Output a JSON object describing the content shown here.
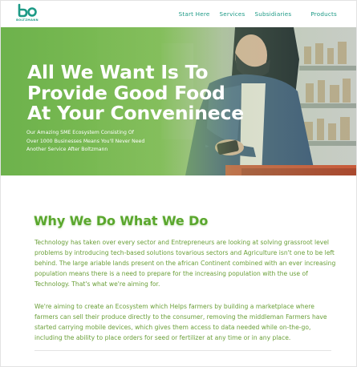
{
  "brand": {
    "logo_text": "BOLTZMANN",
    "accent": "#1d9a86",
    "green": "#5aa72d"
  },
  "nav": {
    "links": [
      {
        "label": "Start Here"
      },
      {
        "label": "Services"
      },
      {
        "label": "Subsidiaries"
      },
      {
        "label": "Products"
      }
    ]
  },
  "hero": {
    "title_line_1": "All We Want Is To",
    "title_line_2": "Provide Good Food",
    "title_line_3": "At Your Conveninece",
    "subtitle_line_1": "Our Amazing SME Ecosystem Consisting Of",
    "subtitle_line_2": "Over 1000 Businesses Means You'll Never Need",
    "subtitle_line_3": "Another Service After Boltzmann"
  },
  "about": {
    "title": "Why We Do What We Do",
    "paragraph_1": "Technology has taken over every sector and Entrepreneurs are looking at solving grassroot level problems by introducing tech-based solutions tovarious sectors and Agriculture isn't one to be left behind. The large ariable lands present on the african Continent combined with an ever increasing population means there is a need to prepare for the increasing population with the use of Technology. That's what we're aiming for.",
    "paragraph_2": "We're aiming to create an Ecosystem which Helps farmers by building a marketplace where farmers can sell their produce directly to the consumer, removing the middleman  Farmers have started carrying mobile devices, which gives them access to data needed while on-the-go, including the ability to place orders for seed or fertilizer at any time or in any place."
  }
}
